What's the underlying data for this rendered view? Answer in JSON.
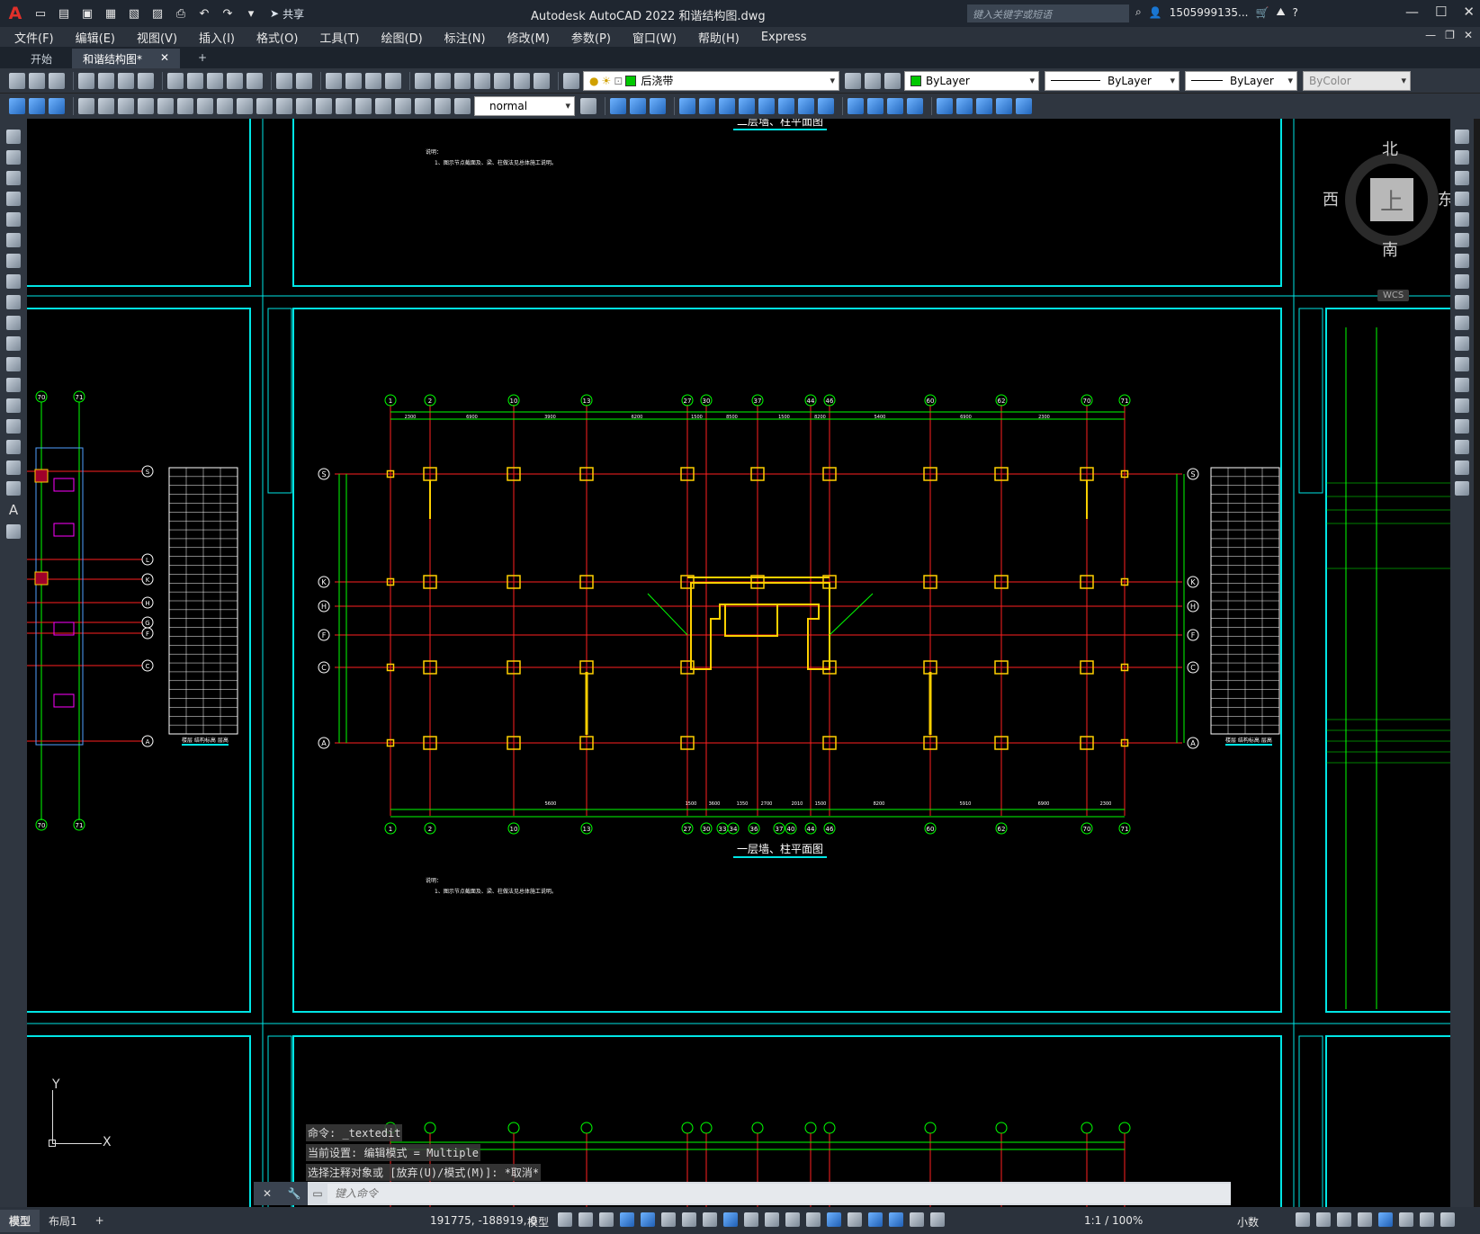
{
  "app": {
    "logo": "A",
    "title": "Autodesk AutoCAD 2022    和谐结构图.dwg",
    "search_placeholder": "键入关键字或短语",
    "user": "1505999135...",
    "share": "共享"
  },
  "menu": [
    "文件(F)",
    "编辑(E)",
    "视图(V)",
    "插入(I)",
    "格式(O)",
    "工具(T)",
    "绘图(D)",
    "标注(N)",
    "修改(M)",
    "参数(P)",
    "窗口(W)",
    "帮助(H)",
    "Express"
  ],
  "file_tabs": {
    "start": "开始",
    "active": "和谐结构图*",
    "close": "✕",
    "plus": "+"
  },
  "toolbar": {
    "layer": "后浇带",
    "color": "ByLayer",
    "linetype": "ByLayer",
    "lineweight": "ByLayer",
    "plotstyle": "ByColor",
    "textstyle": "normal"
  },
  "viewcube": {
    "north": "北",
    "south": "南",
    "east": "东",
    "west": "西",
    "face": "上",
    "wcs": "WCS"
  },
  "drawing": {
    "title_top": "二层墙、柱平面图",
    "title_main": "一层墙、柱平面图",
    "note_label": "说明：",
    "note_text": "1、图示节点截面及、梁、柱做法见总体施工说明。",
    "grid_top": [
      "1",
      "2",
      "10",
      "13",
      "27",
      "30",
      "37",
      "44",
      "46",
      "60",
      "62",
      "70",
      "71"
    ],
    "grid_bottom": [
      "1",
      "2",
      "10",
      "13",
      "27",
      "30",
      "33",
      "34",
      "36",
      "37",
      "40",
      "44",
      "46",
      "60",
      "62",
      "70",
      "71"
    ],
    "grid_rows": [
      "S",
      "K",
      "H",
      "F",
      "C",
      "A"
    ],
    "left_rows": [
      "S",
      "L",
      "K",
      "H",
      "G",
      "F",
      "C",
      "A"
    ],
    "left_cols": [
      "70",
      "71"
    ],
    "dims_top": [
      "2300",
      "6900",
      "3900",
      "6200",
      "1500",
      "8500",
      "1500",
      "8200",
      "5400",
      "6900",
      "2300"
    ],
    "dims_bottom": [
      "5600",
      "1500",
      "3600",
      "1350",
      "2700",
      "2010",
      "1500",
      "8200",
      "5910",
      "6900",
      "2300"
    ],
    "table_caption": "楼层 结构标高 层高"
  },
  "ucs": {
    "x": "X",
    "y": "Y"
  },
  "command_history": [
    "命令: _textedit",
    "当前设置: 编辑模式 = Multiple",
    "选择注释对象或 [放弃(U)/模式(M)]: *取消*"
  ],
  "command_placeholder": "键入命令",
  "status": {
    "model_tab": "模型",
    "layout_tab": "布局1",
    "plus": "+",
    "coords": "191775, -188919, 0",
    "mode": "模型",
    "scale": "1:1 / 100%",
    "units": "小数"
  },
  "colors": {
    "grid_line": "#ff2020",
    "dim_line": "#00ff00",
    "frame": "#00e5e5",
    "column": "#ffd000",
    "accent_magenta": "#ff00ff"
  }
}
